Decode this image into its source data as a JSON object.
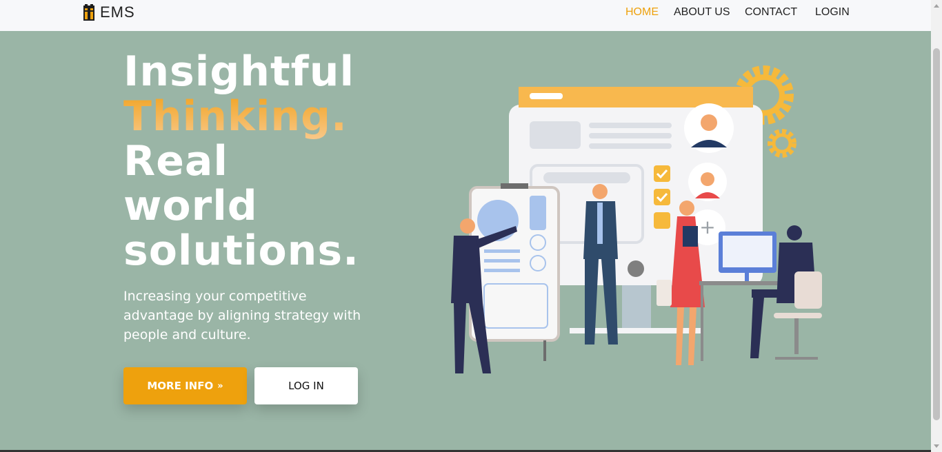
{
  "brand": {
    "name": "EMS",
    "icon": "building-logo-icon"
  },
  "nav": {
    "items": [
      {
        "label": "HOME",
        "active": true
      },
      {
        "label": "ABOUT US",
        "active": false
      },
      {
        "label": "CONTACT",
        "active": false
      },
      {
        "label": "LOGIN",
        "active": false
      }
    ]
  },
  "hero": {
    "line1": "Insightful",
    "line2": "Thinking.",
    "line3": "Real",
    "line4": "world",
    "line5": "solutions.",
    "subtitle": "Increasing your competitive advantage by aligning strategy with people and culture.",
    "more_info_label": "MORE INFO",
    "more_info_icon": "double-chevron-right-icon",
    "login_label": "LOG IN"
  },
  "colors": {
    "background": "#9ab5a6",
    "accent": "#eea10d",
    "navbar": "#f7f8fa"
  }
}
